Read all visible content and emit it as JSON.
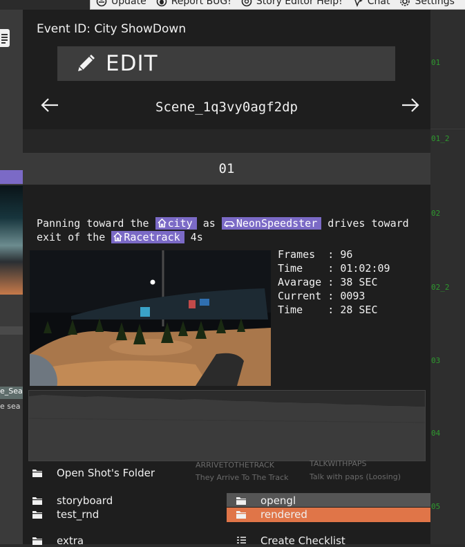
{
  "menubar": {
    "items": [
      {
        "label": "Update",
        "icon": "globe-icon"
      },
      {
        "label": "Report BUG!",
        "icon": "bug-icon"
      },
      {
        "label": "Story Editor Help!",
        "icon": "help-icon"
      },
      {
        "label": "Chat",
        "icon": "chat-icon"
      },
      {
        "label": "Settings",
        "icon": "gear-icon"
      }
    ]
  },
  "left": {
    "label": "e_Sea",
    "sub": "e sea"
  },
  "gutter": [
    "01",
    "01_2",
    "02",
    "02_2",
    "03",
    "04",
    "05"
  ],
  "panel": {
    "event_label": "Event ID: City ShowDown",
    "edit_label": "EDIT",
    "scene_name": "Scene_1q3vy0agf2dp",
    "shot_number": "01",
    "description": {
      "t1": "Panning toward the ",
      "tag1": "city",
      "t2": " as ",
      "tag2": "NeonSpeedster",
      "t3": " drives toward exit of the ",
      "tag3": "Racetrack",
      "t4": " 4s"
    },
    "stats": [
      {
        "key": "Frames ",
        "value": "96"
      },
      {
        "key": "Time   ",
        "value": "01:02:09"
      },
      {
        "key": "Avarage",
        "value": "38 SEC"
      },
      {
        "key": "Current",
        "value": "0093"
      },
      {
        "key": "Time   ",
        "value": "28 SEC"
      }
    ],
    "ghost": {
      "a": "ARRIVETOTHETRACK",
      "b": "TALKWITHPAPS",
      "c": "They Arrive To The Track",
      "d": "Talk with paps (Loosing)"
    },
    "open_folder": "Open Shot's Folder",
    "folders_left": [
      "storyboard",
      "test_rnd",
      "extra"
    ],
    "folders_right": [
      "opengl",
      "rendered"
    ],
    "checklist": "Create Checklist"
  },
  "colors": {
    "tag": "#7b6ac6",
    "selected": "#e07548",
    "gutter_text": "#2e9a2e"
  }
}
